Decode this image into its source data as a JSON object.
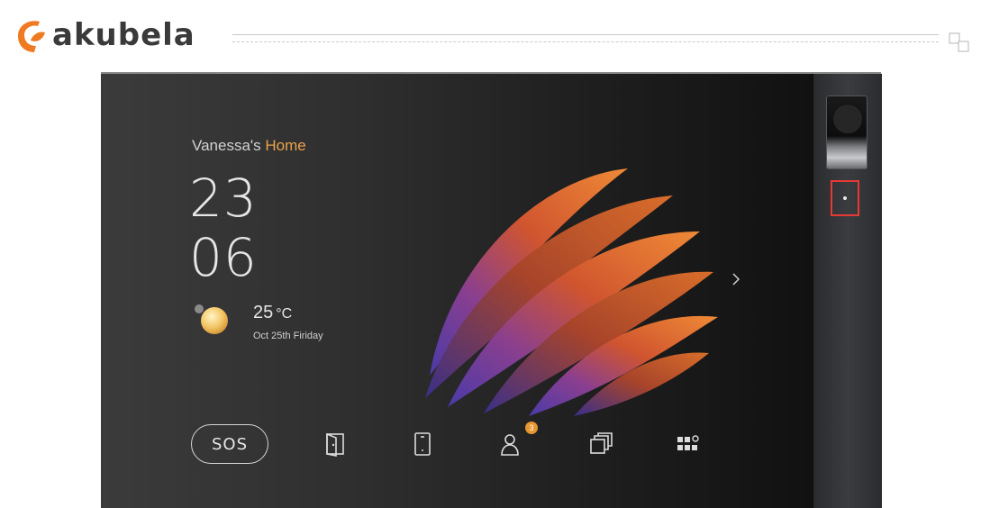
{
  "brand": {
    "name": "akubela",
    "accent": "#f07a22"
  },
  "screen": {
    "home_owner": "Vanessa's",
    "home_word": "Home",
    "time_hour": "23",
    "time_minute": "06",
    "temperature_value": "25",
    "temperature_unit": "°C",
    "date": "Oct 25th Firiday",
    "weather_icon": "sun-icon"
  },
  "dock": {
    "sos_label": "SOS",
    "icons": [
      "door-icon",
      "tablet-icon",
      "contacts-icon",
      "windows-icon",
      "apps-grid-icon"
    ],
    "contacts_badge": "3",
    "badge_color": "#e8962f"
  },
  "colors": {
    "highlight": "#e9a24b",
    "indicator_outline": "#e53935"
  }
}
